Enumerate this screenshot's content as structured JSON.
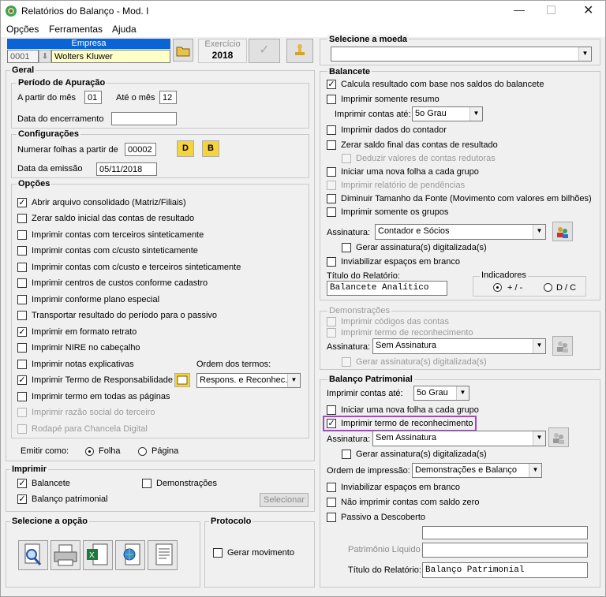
{
  "window": {
    "title": "Relatórios do Balanço - Mod. I"
  },
  "menu": [
    "Opções",
    "Ferramentas",
    "Ajuda"
  ],
  "empresa": {
    "header": "Empresa",
    "code": "0001",
    "name": "Wolters Kluwer"
  },
  "exercicio": {
    "label": "Exercício",
    "year": "2018"
  },
  "geral": {
    "title": "Geral"
  },
  "periodo": {
    "title": "Período de Apuração",
    "from_label": "A partir do mês",
    "from_value": "01",
    "to_label": "Até o mês",
    "to_value": "12",
    "closing_label": "Data do encerramento",
    "closing_value": ""
  },
  "config": {
    "title": "Configurações",
    "number_label": "Numerar folhas a partir de",
    "number_value": "00002",
    "btn_d": "D",
    "btn_b": "B",
    "date_label": "Data da emissão",
    "date_value": "05/11/2018"
  },
  "opcoes": {
    "title": "Opções",
    "items": [
      {
        "label": "Abrir arquivo consolidado (Matriz/Filiais)",
        "checked": true,
        "disabled": false
      },
      {
        "label": "Zerar saldo inicial das contas de resultado",
        "checked": false,
        "disabled": false
      },
      {
        "label": "Imprimir contas com terceiros sinteticamente",
        "checked": false,
        "disabled": false
      },
      {
        "label": "Imprimir contas com c/custo sinteticamente",
        "checked": false,
        "disabled": false
      },
      {
        "label": "Imprimir contas com c/custo e terceiros sinteticamente",
        "checked": false,
        "disabled": false
      },
      {
        "label": "Imprimir centros de custos conforme cadastro",
        "checked": false,
        "disabled": false
      },
      {
        "label": "Imprimir conforme plano especial",
        "checked": false,
        "disabled": false
      },
      {
        "label": "Transportar resultado do período para o passivo",
        "checked": false,
        "disabled": false
      },
      {
        "label": "Imprimir em formato retrato",
        "checked": true,
        "disabled": false
      },
      {
        "label": "Imprimir NIRE no cabeçalho",
        "checked": false,
        "disabled": false
      },
      {
        "label": "Imprimir notas explicativas",
        "checked": false,
        "disabled": false
      },
      {
        "label": "Imprimir Termo de Responsabilidade",
        "checked": true,
        "disabled": false
      },
      {
        "label": "Imprimir termo em todas as páginas",
        "checked": false,
        "disabled": false
      },
      {
        "label": "Imprimir razão social do terceiro",
        "checked": false,
        "disabled": true
      },
      {
        "label": "Rodapé para Chancela Digital",
        "checked": false,
        "disabled": true
      }
    ],
    "ordem_label": "Ordem dos termos:",
    "ordem_value": "Respons. e Reconhec."
  },
  "emitir": {
    "label": "Emitir como:",
    "folha": "Folha",
    "pagina": "Página"
  },
  "imprimir": {
    "title": "Imprimir",
    "balancete": "Balancete",
    "balanco": "Balanço patrimonial",
    "demonstracoes": "Demonstrações",
    "selecionar": "Selecionar"
  },
  "selecione": {
    "title": "Selecione a opção"
  },
  "protocolo": {
    "title": "Protocolo",
    "gerar": "Gerar movimento"
  },
  "moeda": {
    "title": "Selecione a moeda",
    "value": ""
  },
  "balancete": {
    "title": "Balancete",
    "calcula": "Calcula resultado com base nos saldos do balancete",
    "resumo": "Imprimir somente resumo",
    "contas_label": "Imprimir contas até:",
    "contas_value": "5o Grau",
    "contador": "Imprimir dados do contador",
    "zerar": "Zerar saldo final das contas de resultado",
    "deduzir": "Deduzir valores de contas redutoras",
    "nova_folha": "Iniciar uma nova folha a cada grupo",
    "pendencias": "Imprimir relatório de pendências",
    "diminuir": "Diminuir Tamanho da Fonte (Movimento com valores em bilhões)",
    "grupos": "Imprimir somente os grupos",
    "assinatura_label": "Assinatura:",
    "assinatura_value": "Contador e Sócios",
    "gerar_assin": "Gerar assinatura(s) digitalizada(s)",
    "inviabilizar": "Inviabilizar espaços em branco",
    "titulo_label": "Título do Relatório:",
    "titulo_value": "Balancete Analítico",
    "indicadores": "Indicadores",
    "ind_1": "+ / -",
    "ind_2": "D / C"
  },
  "demonstracoes": {
    "title": "Demonstrações",
    "codigos": "Imprimir códigos das contas",
    "termo": "Imprimir termo de reconhecimento",
    "assinatura_label": "Assinatura:",
    "assinatura_value": "Sem Assinatura",
    "gerar_assin": "Gerar assinatura(s) digitalizada(s)"
  },
  "balanco": {
    "title": "Balanço Patrimonial",
    "contas_label": "Imprimir contas até:",
    "contas_value": "5o Grau",
    "nova_folha": "Iniciar uma nova folha a cada grupo",
    "termo": "Imprimir termo de reconhecimento",
    "assinatura_label": "Assinatura:",
    "assinatura_value": "Sem Assinatura",
    "gerar_assin": "Gerar assinatura(s) digitalizada(s)",
    "ordem_label": "Ordem de impressão:",
    "ordem_value": "Demonstrações e Balanço",
    "inviabilizar": "Inviabilizar espaços em branco",
    "nao_imprimir": "Não imprimir contas com saldo zero",
    "passivo": "Passivo a Descoberto",
    "pl_label": "Patrimônio Líquido",
    "titulo_label": "Título do Relatório:",
    "titulo_value": "Balanço Patrimonial"
  },
  "colors": {
    "highlight_box": "#9b4fb4",
    "empresa_header": "#0a64d6"
  }
}
